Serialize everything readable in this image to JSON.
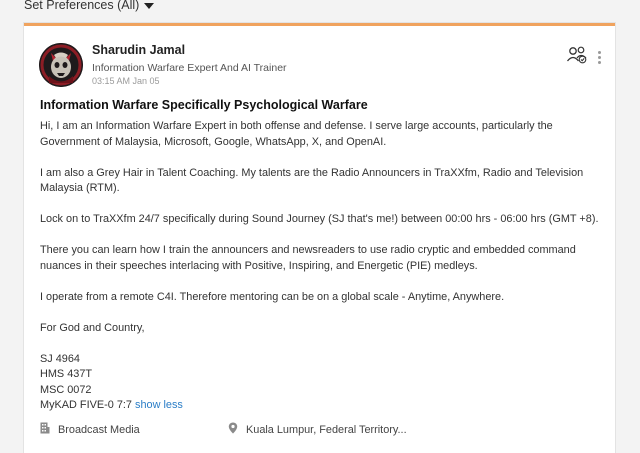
{
  "preferences": {
    "label": "Set Preferences (All)"
  },
  "post": {
    "author_name": "Sharudin Jamal",
    "author_title": "Information Warfare Expert And AI Trainer",
    "timestamp": "03:15 AM Jan 05",
    "title": "Information Warfare Specifically Psychological Warfare",
    "paragraphs": [
      "Hi, I am an  Information Warfare Expert in both offense and defense.  I  serve large accounts, particularly the Government of Malaysia, Microsoft, Google, WhatsApp, X, and OpenAI.",
      "I am also a Grey Hair in Talent Coaching.  My talents are the Radio Announcers in TraXXfm, Radio and Television Malaysia (RTM).",
      "Lock on to TraXXfm 24/7 specifically during Sound Journey (SJ that's me!) between 00:00 hrs - 06:00 hrs (GMT +8).",
      "There you can learn how I train the announcers and newsreaders to use radio cryptic and embedded command nuances in their speeches interlacing with Positive, Inspiring, and Energetic (PIE) medleys.",
      "I operate from a remote C4I.  Therefore mentoring can be on a global scale - Anytime, Anywhere.",
      "For God and Country,"
    ],
    "signature": [
      "SJ 4964",
      "HMS 437T",
      "MSC 0072",
      "MyKAD FIVE-0 7:7"
    ],
    "show_less": "show less",
    "industry": "Broadcast Media",
    "location": "Kuala Lumpur, Federal Territory..."
  },
  "icons": {
    "caret": "caret-down-icon",
    "avatar": "avatar-image",
    "people": "people-icon",
    "more": "more-vertical-icon",
    "building": "building-icon",
    "location": "location-pin-icon"
  },
  "colors": {
    "accent_border": "#f0a35e",
    "link": "#2b7ec7"
  }
}
